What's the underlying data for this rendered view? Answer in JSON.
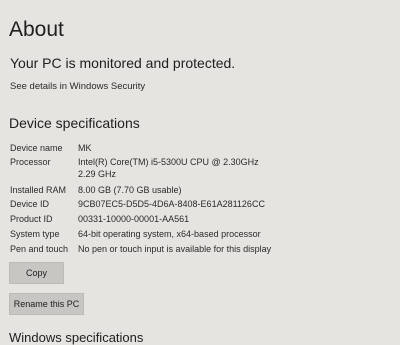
{
  "page": {
    "title": "About",
    "protection_status": "Your PC is monitored and protected.",
    "security_link": "See details in Windows Security"
  },
  "device_specs": {
    "heading": "Device specifications",
    "rows": [
      {
        "label": "Device name",
        "value": "MK"
      },
      {
        "label": "Processor",
        "value": "Intel(R) Core(TM) i5-5300U CPU @ 2.30GHz   2.29 GHz"
      },
      {
        "label": "Installed RAM",
        "value": "8.00 GB (7.70 GB usable)"
      },
      {
        "label": "Device ID",
        "value": "9CB07EC5-D5D5-4D6A-8408-E61A281126CC"
      },
      {
        "label": "Product ID",
        "value": "00331-10000-00001-AA561"
      },
      {
        "label": "System type",
        "value": "64-bit operating system, x64-based processor"
      },
      {
        "label": "Pen and touch",
        "value": "No pen or touch input is available for this display"
      }
    ],
    "copy_label": "Copy",
    "rename_label": "Rename this PC"
  },
  "windows_specs": {
    "heading": "Windows specifications"
  }
}
